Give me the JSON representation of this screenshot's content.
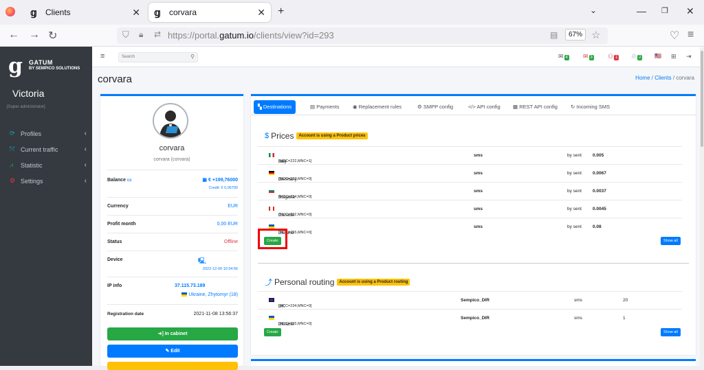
{
  "browser": {
    "tabs": [
      {
        "label": "Clients"
      },
      {
        "label": "corvara"
      }
    ],
    "url_prefix": "https://portal.",
    "url_domain": "gatum.io",
    "url_path": "/clients/view?id=293",
    "zoom": "67%"
  },
  "sidebar": {
    "brand_title": "GATUM",
    "brand_sub": "BY SEMPICO SOLUTIONS",
    "user_name": "Victoria",
    "user_role": "[Super administrator]",
    "items": [
      {
        "label": "Profiles",
        "icon": "profiles-icon",
        "color": "#17a2b8"
      },
      {
        "label": "Current traffic",
        "icon": "traffic-icon",
        "color": "#17a2b8"
      },
      {
        "label": "Statistic",
        "icon": "chart-icon",
        "color": "#28a745"
      },
      {
        "label": "Settings",
        "icon": "settings-icon",
        "color": "#dc3545"
      }
    ]
  },
  "topbar": {
    "search_placeholder": "Search",
    "badges": [
      {
        "count": "4",
        "color": "#28a745"
      },
      {
        "count": "3",
        "color": "#28a745"
      },
      {
        "count": "1",
        "color": "#dc3545"
      },
      {
        "count": "2",
        "color": "#28a745"
      }
    ]
  },
  "page": {
    "title": "corvara",
    "breadcrumb": [
      "Home",
      "Clients",
      "corvara"
    ]
  },
  "profile": {
    "name": "corvara",
    "sub": "corvara (corvara)",
    "balance_label": "Balance",
    "balance_value": "€ +199,76000",
    "balance_credit": "Credit: € 0,06700",
    "currency_label": "Currency",
    "currency_value": "EUR",
    "profit_label": "Profit month",
    "profit_value": "0,00 EUR",
    "status_label": "Status",
    "status_value": "Offline",
    "device_label": "Device",
    "device_time": "2022-12-09 10:34:56",
    "ip_label": "IP info",
    "ip_value": "37.115.73.189",
    "ip_location": "Ukraine, Zhytomyr (18)",
    "reg_label": "Registration date",
    "reg_value": "2021-11-08 13:56:37",
    "btn_cabinet": "In cabinet",
    "btn_edit": "Edit"
  },
  "tabs": [
    {
      "label": "Destinations",
      "active": true
    },
    {
      "label": "Payments"
    },
    {
      "label": "Replacement rules"
    },
    {
      "label": "SMPP config"
    },
    {
      "label": "API config"
    },
    {
      "label": "REST API config"
    },
    {
      "label": "Incoming SMS"
    }
  ],
  "prices": {
    "title": "Prices",
    "badge": "Account is using a Product prices",
    "rows": [
      {
        "country": "Italy",
        "code": "[MCC=222,MNC=1]",
        "type": "sms",
        "mode": "by sent",
        "price": "0.005"
      },
      {
        "country": "Germany",
        "code": "[MCC=262,MNC=0]",
        "type": "sms",
        "mode": "by sent",
        "price": "0.0067"
      },
      {
        "country": "Bulgaria",
        "code": "[MCC=284,MNC=0]",
        "type": "sms",
        "mode": "by sent",
        "price": "0.0037"
      },
      {
        "country": "Canada",
        "code": "[MCC=302,MNC=0]",
        "type": "sms",
        "mode": "by sent",
        "price": "0.0045"
      },
      {
        "country": "Ukraine",
        "code": "[MCC=255,MNC=0]",
        "type": "sms",
        "mode": "by sent",
        "price": "0.08"
      }
    ],
    "create": "Create",
    "show_all": "Show all"
  },
  "routing": {
    "title": "Personal routing",
    "badge": "Account is using a Product routing",
    "rows": [
      {
        "country": "UK",
        "code": "[MCC=234,MNC=0]",
        "route": "Sempico_DIR",
        "type": "sms",
        "priority": "20"
      },
      {
        "country": "Ukraine",
        "code": "[MCC=255,MNC=0]",
        "route": "Sempico_DIR",
        "type": "sms",
        "priority": "1"
      }
    ],
    "create": "Create",
    "show_all": "Show all"
  }
}
